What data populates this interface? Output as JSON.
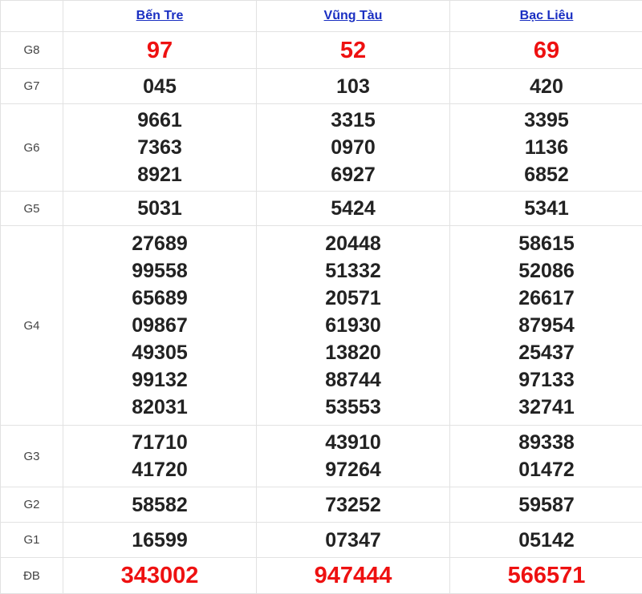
{
  "header": {
    "provinces": [
      "Bến Tre",
      "Vũng Tàu",
      "Bạc Liêu"
    ]
  },
  "colors": {
    "link": "#1a2fc2",
    "highlight": "#ee1111",
    "text": "#222222",
    "border": "#e2e2e2"
  },
  "prizes": [
    {
      "label": "G8",
      "cols": [
        [
          "97"
        ],
        [
          "52"
        ],
        [
          "69"
        ]
      ]
    },
    {
      "label": "G7",
      "cols": [
        [
          "045"
        ],
        [
          "103"
        ],
        [
          "420"
        ]
      ]
    },
    {
      "label": "G6",
      "cols": [
        [
          "9661",
          "7363",
          "8921"
        ],
        [
          "3315",
          "0970",
          "6927"
        ],
        [
          "3395",
          "1136",
          "6852"
        ]
      ]
    },
    {
      "label": "G5",
      "cols": [
        [
          "5031"
        ],
        [
          "5424"
        ],
        [
          "5341"
        ]
      ]
    },
    {
      "label": "G4",
      "cols": [
        [
          "27689",
          "99558",
          "65689",
          "09867",
          "49305",
          "99132",
          "82031"
        ],
        [
          "20448",
          "51332",
          "20571",
          "61930",
          "13820",
          "88744",
          "53553"
        ],
        [
          "58615",
          "52086",
          "26617",
          "87954",
          "25437",
          "97133",
          "32741"
        ]
      ]
    },
    {
      "label": "G3",
      "cols": [
        [
          "71710",
          "41720"
        ],
        [
          "43910",
          "97264"
        ],
        [
          "89338",
          "01472"
        ]
      ]
    },
    {
      "label": "G2",
      "cols": [
        [
          "58582"
        ],
        [
          "73252"
        ],
        [
          "59587"
        ]
      ]
    },
    {
      "label": "G1",
      "cols": [
        [
          "16599"
        ],
        [
          "07347"
        ],
        [
          "05142"
        ]
      ]
    },
    {
      "label": "ĐB",
      "cols": [
        [
          "343002"
        ],
        [
          "947444"
        ],
        [
          "566571"
        ]
      ]
    }
  ]
}
